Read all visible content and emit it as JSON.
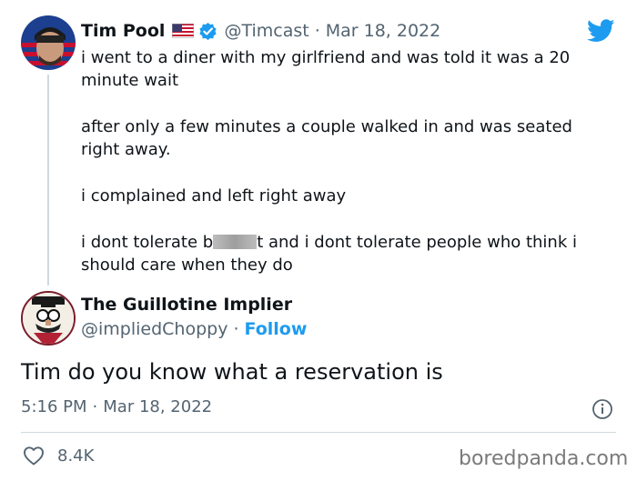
{
  "quoted_tweet": {
    "display_name": "Tim Pool",
    "flag_icon": "us-flag-icon",
    "verified_icon": "verified-badge-icon",
    "handle": "@Timcast",
    "separator": "·",
    "date": "Mar 18, 2022",
    "text_lines": {
      "p1a": "i went to a diner with my girlfriend and was told it was a 20",
      "p1b": "minute wait",
      "p2a": "after only a few minutes a couple walked in and was seated",
      "p2b": "right away.",
      "p3": "i complained and left right away",
      "p4a_pre": "i dont tolerate b",
      "p4a_post": "t and i dont tolerate people who think i",
      "p4b": "should care when they do"
    }
  },
  "reply_tweet": {
    "display_name": "The Guillotine Implier",
    "handle": "@impliedChoppy",
    "separator": "·",
    "follow_label": "Follow",
    "text": "Tim do you know what a reservation is",
    "time": "5:16 PM",
    "date": "Mar 18, 2022",
    "likes": "8.4K"
  },
  "watermark": "boredpanda.com",
  "colors": {
    "twitter_blue": "#1d9bf0",
    "text": "#0f1419",
    "muted": "#536471"
  }
}
